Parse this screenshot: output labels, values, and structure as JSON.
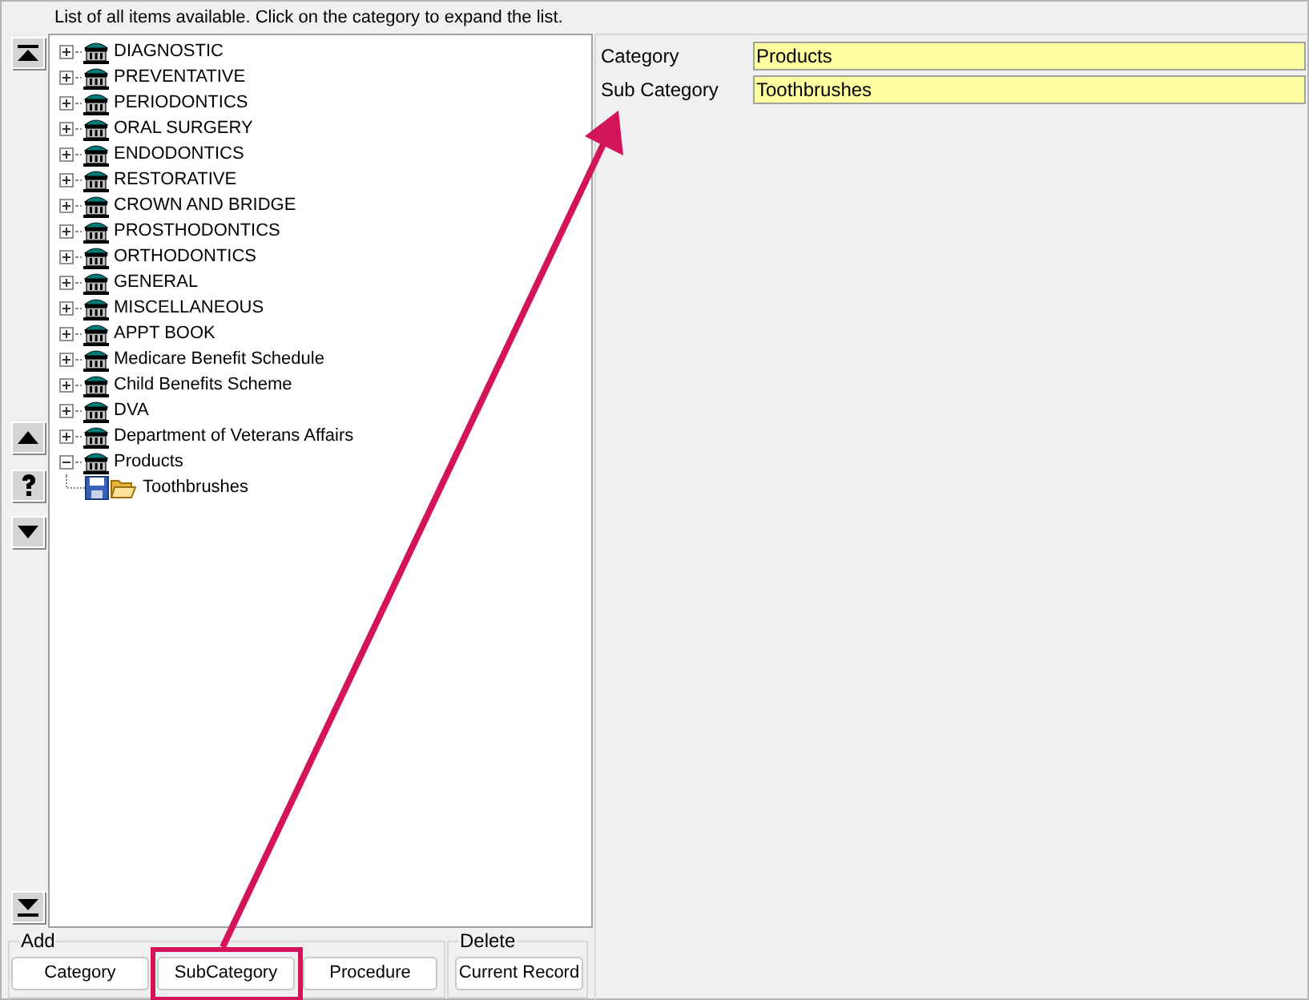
{
  "header": "List of all items available. Click on the category to expand the list.",
  "tree": [
    {
      "label": "DIAGNOSTIC",
      "expanded": false
    },
    {
      "label": "PREVENTATIVE",
      "expanded": false
    },
    {
      "label": "PERIODONTICS",
      "expanded": false
    },
    {
      "label": "ORAL SURGERY",
      "expanded": false
    },
    {
      "label": "ENDODONTICS",
      "expanded": false
    },
    {
      "label": "RESTORATIVE",
      "expanded": false
    },
    {
      "label": "CROWN AND BRIDGE",
      "expanded": false
    },
    {
      "label": "PROSTHODONTICS",
      "expanded": false
    },
    {
      "label": "ORTHODONTICS",
      "expanded": false
    },
    {
      "label": "GENERAL",
      "expanded": false
    },
    {
      "label": "MISCELLANEOUS",
      "expanded": false
    },
    {
      "label": "APPT BOOK",
      "expanded": false
    },
    {
      "label": "Medicare Benefit Schedule",
      "expanded": false
    },
    {
      "label": "Child Benefits Scheme",
      "expanded": false
    },
    {
      "label": "DVA",
      "expanded": false
    },
    {
      "label": "Department of Veterans Affairs",
      "expanded": false
    },
    {
      "label": "Products",
      "expanded": true,
      "children": [
        {
          "label": "Toothbrushes"
        }
      ]
    }
  ],
  "add_group": {
    "title": "Add",
    "buttons": [
      "Category",
      "SubCategory",
      "Procedure"
    ]
  },
  "delete_group": {
    "title": "Delete",
    "buttons": [
      "Current Record"
    ]
  },
  "details": [
    {
      "label": "Category",
      "value": "Products"
    },
    {
      "label": "Sub Category",
      "value": "Toothbrushes"
    }
  ]
}
